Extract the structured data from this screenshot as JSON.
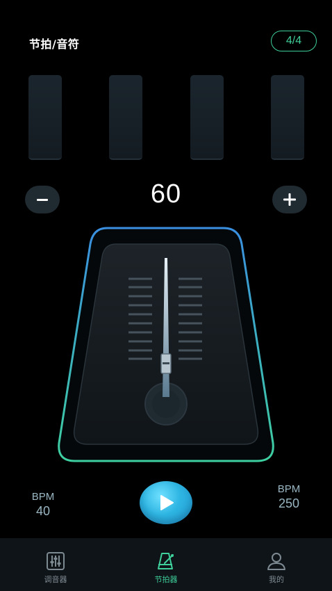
{
  "header": {
    "title": "节拍/音符",
    "time_signature": "4/4"
  },
  "beats": {
    "count": 4
  },
  "tempo": {
    "bpm": "60",
    "minus_symbol": "−",
    "plus_symbol": "+"
  },
  "range": {
    "min_label": "BPM",
    "min_value": "40",
    "max_label": "BPM",
    "max_value": "250"
  },
  "tabbar": {
    "tuner": "调音器",
    "metronome": "节拍器",
    "profile": "我的"
  },
  "colors": {
    "accent_green": "#3ecf9a",
    "accent_blue": "#2fb6e3",
    "background": "#000000"
  }
}
